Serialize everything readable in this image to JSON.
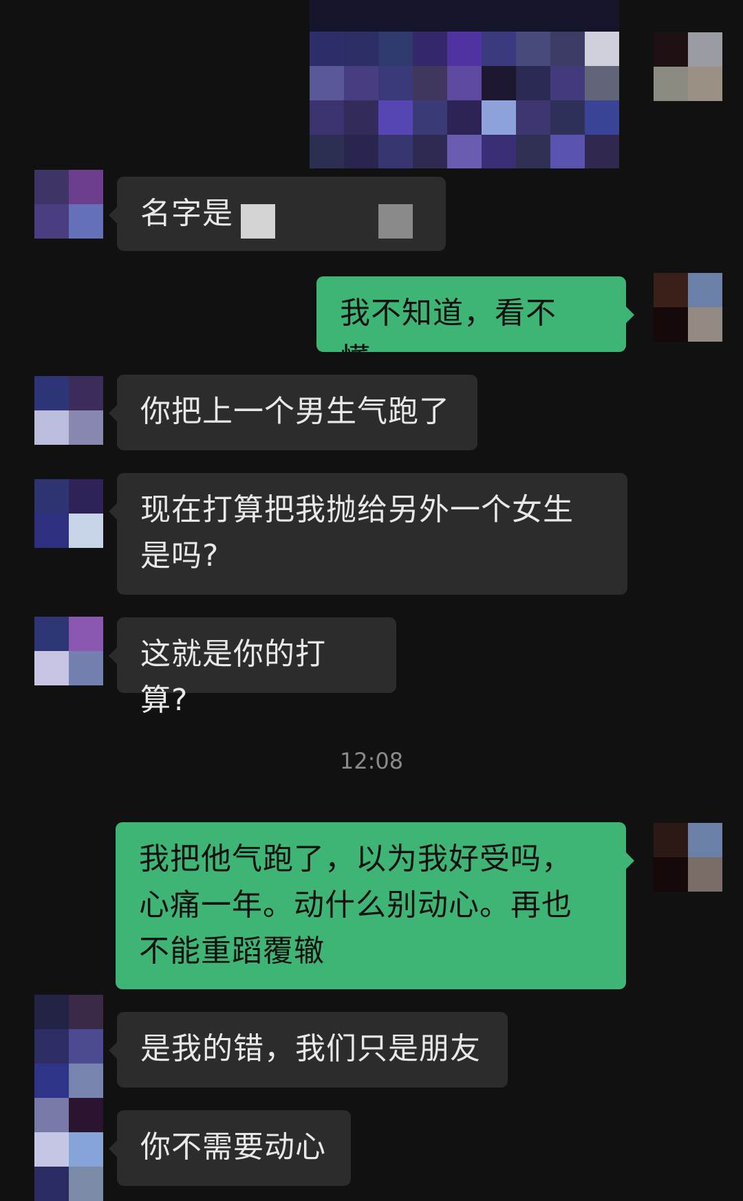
{
  "messages": [
    {
      "side": "in",
      "text": "名字是"
    },
    {
      "side": "out",
      "text": "我不知道，看不懂。"
    },
    {
      "side": "in",
      "text": "你把上一个男生气跑了"
    },
    {
      "side": "in",
      "text": "现在打算把我抛给另外一个女生是吗?"
    },
    {
      "side": "in",
      "text": "这就是你的打算?"
    },
    {
      "side": "out",
      "text": "我把他气跑了，以为我好受吗，心痛一年。动什么别动心。再也不能重蹈覆辙"
    },
    {
      "side": "in",
      "text": "是我的错，我们只是朋友"
    },
    {
      "side": "in",
      "text": "你不需要动心"
    }
  ],
  "timestamp": "12:08",
  "colors": {
    "background": "#111111",
    "incoming_bubble": "#2c2c2c",
    "outgoing_bubble": "#3eb574",
    "incoming_text": "#e8e8e8",
    "outgoing_text": "#111111",
    "timestamp": "#8a8a8a"
  }
}
